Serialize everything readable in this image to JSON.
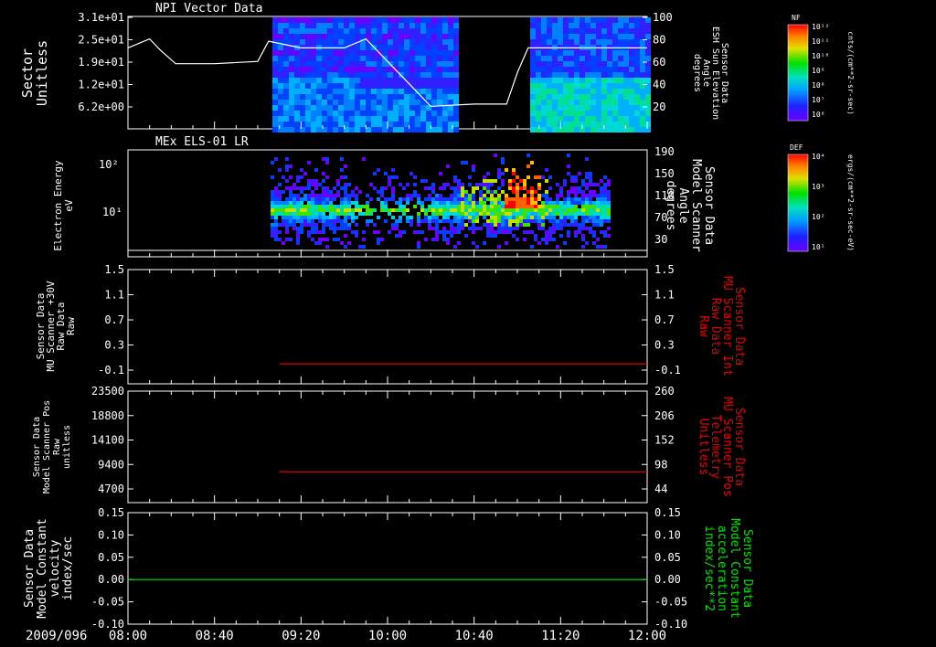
{
  "date_label": "2009/096",
  "time_ticks": [
    "08:00",
    "08:40",
    "09:20",
    "10:00",
    "10:40",
    "11:20",
    "12:00"
  ],
  "colors": {
    "white": "#ffffff",
    "red": "#e00000",
    "green": "#00e000",
    "background": "#000000"
  },
  "chart_data": [
    {
      "type": "heatmap",
      "title": "NPI Vector Data",
      "ylabel": [
        "Sector",
        "Unitless"
      ],
      "yticks": [
        "3.1e+01",
        "2.5e+01",
        "1.9e+01",
        "1.2e+01",
        "6.2e+00"
      ],
      "right_label": [
        "Sensor Data",
        "ESH Sun Elevation",
        "Angle",
        "degrees"
      ],
      "right_ticks": [
        "100",
        "80",
        "60",
        "40",
        "20"
      ],
      "colorbar": {
        "title": "NF",
        "units": "cnts/(cm**2-sr-sec)",
        "ticks": [
          "10¹²",
          "10¹¹",
          "10¹⁰",
          "10⁹",
          "10⁸",
          "10⁷",
          "10⁶"
        ]
      },
      "overlay_line": {
        "name": "ESH Sun Elevation Angle",
        "x": [
          "08:00",
          "08:10",
          "08:15",
          "08:22",
          "08:40",
          "09:00",
          "09:05",
          "09:20",
          "09:40",
          "09:50",
          "10:00",
          "10:10",
          "10:20",
          "10:40",
          "10:55",
          "11:00",
          "11:05",
          "11:20",
          "12:00"
        ],
        "y": [
          72,
          80,
          70,
          58,
          58,
          60,
          78,
          72,
          72,
          80,
          60,
          40,
          20,
          22,
          22,
          50,
          72,
          72,
          72
        ]
      }
    },
    {
      "type": "heatmap",
      "title": "MEx ELS-01 LR",
      "ylabel": [
        "Electron Energy",
        "eV"
      ],
      "yticks": [
        "10²",
        "10¹"
      ],
      "right_label": [
        "Sensor Data",
        "Model Scanner",
        "Angle",
        "degrees"
      ],
      "right_ticks": [
        "190",
        "150",
        "110",
        "70",
        "30"
      ],
      "colorbar": {
        "title": "DEF",
        "units": "ergs/(cm**2-sr-sec-eV)",
        "ticks": [
          "10⁴",
          "10³",
          "10²",
          "10¹"
        ]
      }
    },
    {
      "type": "line",
      "ylabel": [
        "Sensor Data",
        "MU Scanner +30V",
        "Raw Data",
        "Raw"
      ],
      "yticks": [
        "1.5",
        "1.1",
        "0.7",
        "0.3",
        "-0.1"
      ],
      "right_label": [
        "Sensor Data",
        "MU Scanner Int",
        "Raw Data",
        "Raw"
      ],
      "right_ticks": [
        "1.5",
        "1.1",
        "0.7",
        "0.3",
        "-0.1"
      ],
      "series": [
        {
          "color": "#e00000",
          "x_start": "09:10",
          "x_end": "12:00",
          "y": 0.0
        }
      ]
    },
    {
      "type": "line",
      "ylabel": [
        "Sensor Data",
        "Model Scanner Pos",
        "Raw",
        "unitless"
      ],
      "yticks": [
        "23500",
        "18800",
        "14100",
        "9400",
        "4700"
      ],
      "right_label": [
        "Sensor Data",
        "MU Scanner Pos",
        "Telemetry",
        "Unitless"
      ],
      "right_ticks": [
        "260",
        "206",
        "152",
        "98",
        "44"
      ],
      "series": [
        {
          "color": "#e00000",
          "x_start": "09:10",
          "x_end": "12:00",
          "y": 8000
        }
      ]
    },
    {
      "type": "line",
      "ylabel": [
        "Sensor Data",
        "Model Constant",
        "velocity",
        "index/sec"
      ],
      "yticks": [
        "0.15",
        "0.10",
        "0.05",
        "0.00",
        "-0.05",
        "-0.10"
      ],
      "right_label": [
        "Sensor Data",
        "Model Constant",
        "acceleration",
        "index/sec**2"
      ],
      "right_ticks": [
        "0.15",
        "0.10",
        "0.05",
        "0.00",
        "-0.05",
        "-0.10"
      ],
      "series": [
        {
          "color": "#00e000",
          "x_start": "08:00",
          "x_end": "12:00",
          "y": 0.0
        }
      ]
    }
  ]
}
